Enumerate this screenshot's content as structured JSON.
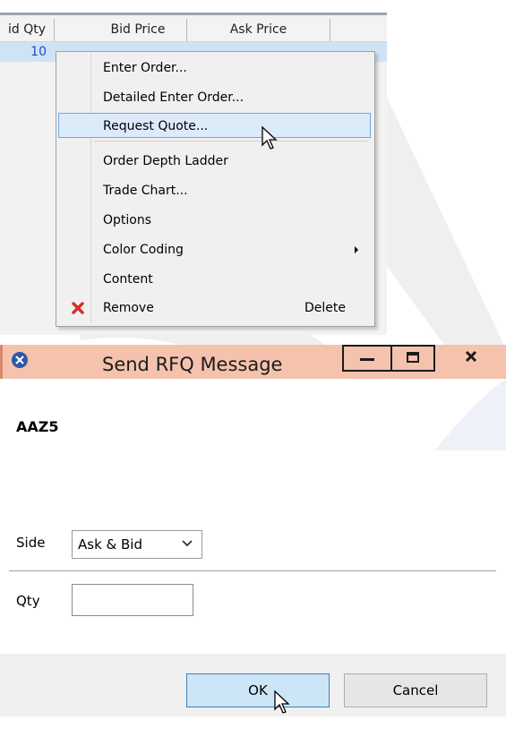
{
  "grid": {
    "columns": [
      "id Qty",
      "Bid Price",
      "Ask Price"
    ],
    "row": {
      "qty": "10"
    }
  },
  "context_menu": {
    "items": [
      {
        "label": "Enter Order..."
      },
      {
        "label": "Detailed Enter Order..."
      },
      {
        "label": "Request Quote..."
      },
      {
        "label": "Order Depth Ladder"
      },
      {
        "label": "Trade Chart..."
      },
      {
        "label": "Options"
      },
      {
        "label": "Color Coding"
      },
      {
        "label": "Content"
      },
      {
        "label": "Remove",
        "shortcut": "Delete",
        "icon": "red-x-icon"
      }
    ],
    "highlighted_item": "Request Quote..."
  },
  "dialog": {
    "title": "Send RFQ Message",
    "symbol": "AAZ5",
    "side_label": "Side",
    "side_value": "Ask & Bid",
    "qty_label": "Qty",
    "qty_value": "",
    "ok_label": "OK",
    "cancel_label": "Cancel",
    "titlebar_color": "#f4c2ad"
  }
}
